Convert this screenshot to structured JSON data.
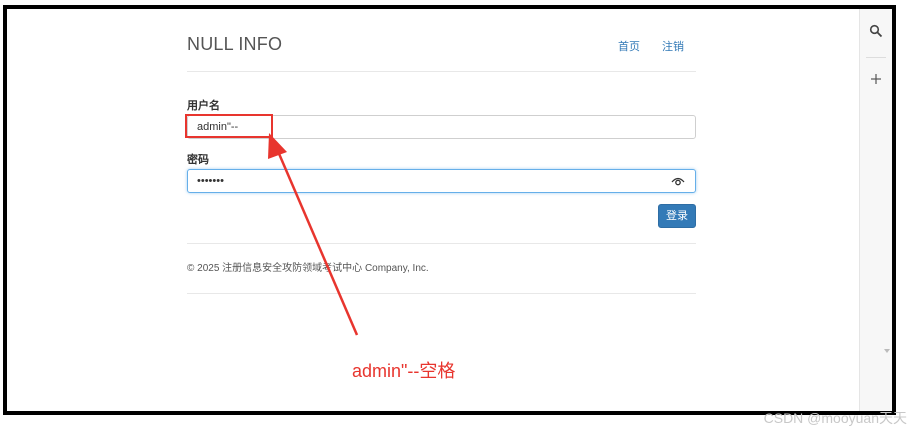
{
  "header": {
    "brand": "NULL INFO",
    "nav": [
      {
        "label": "首页"
      },
      {
        "label": "注销"
      }
    ]
  },
  "form": {
    "username_label": "用户名",
    "username_value": "admin\"--",
    "password_label": "密码",
    "password_value": "•••••••",
    "submit_label": "登录"
  },
  "footer": {
    "copyright": "© 2025 注册信息安全攻防领域考试中心 Company, Inc."
  },
  "annotation": {
    "text": "admin\"--空格",
    "color": "#e8352e"
  },
  "sidebar": {
    "icons": [
      "search-icon",
      "plus-icon"
    ]
  },
  "watermark": "CSDN @mooyuan天天",
  "colors": {
    "primary": "#337ab7",
    "annotation": "#e8352e",
    "focus": "#66afe9"
  }
}
